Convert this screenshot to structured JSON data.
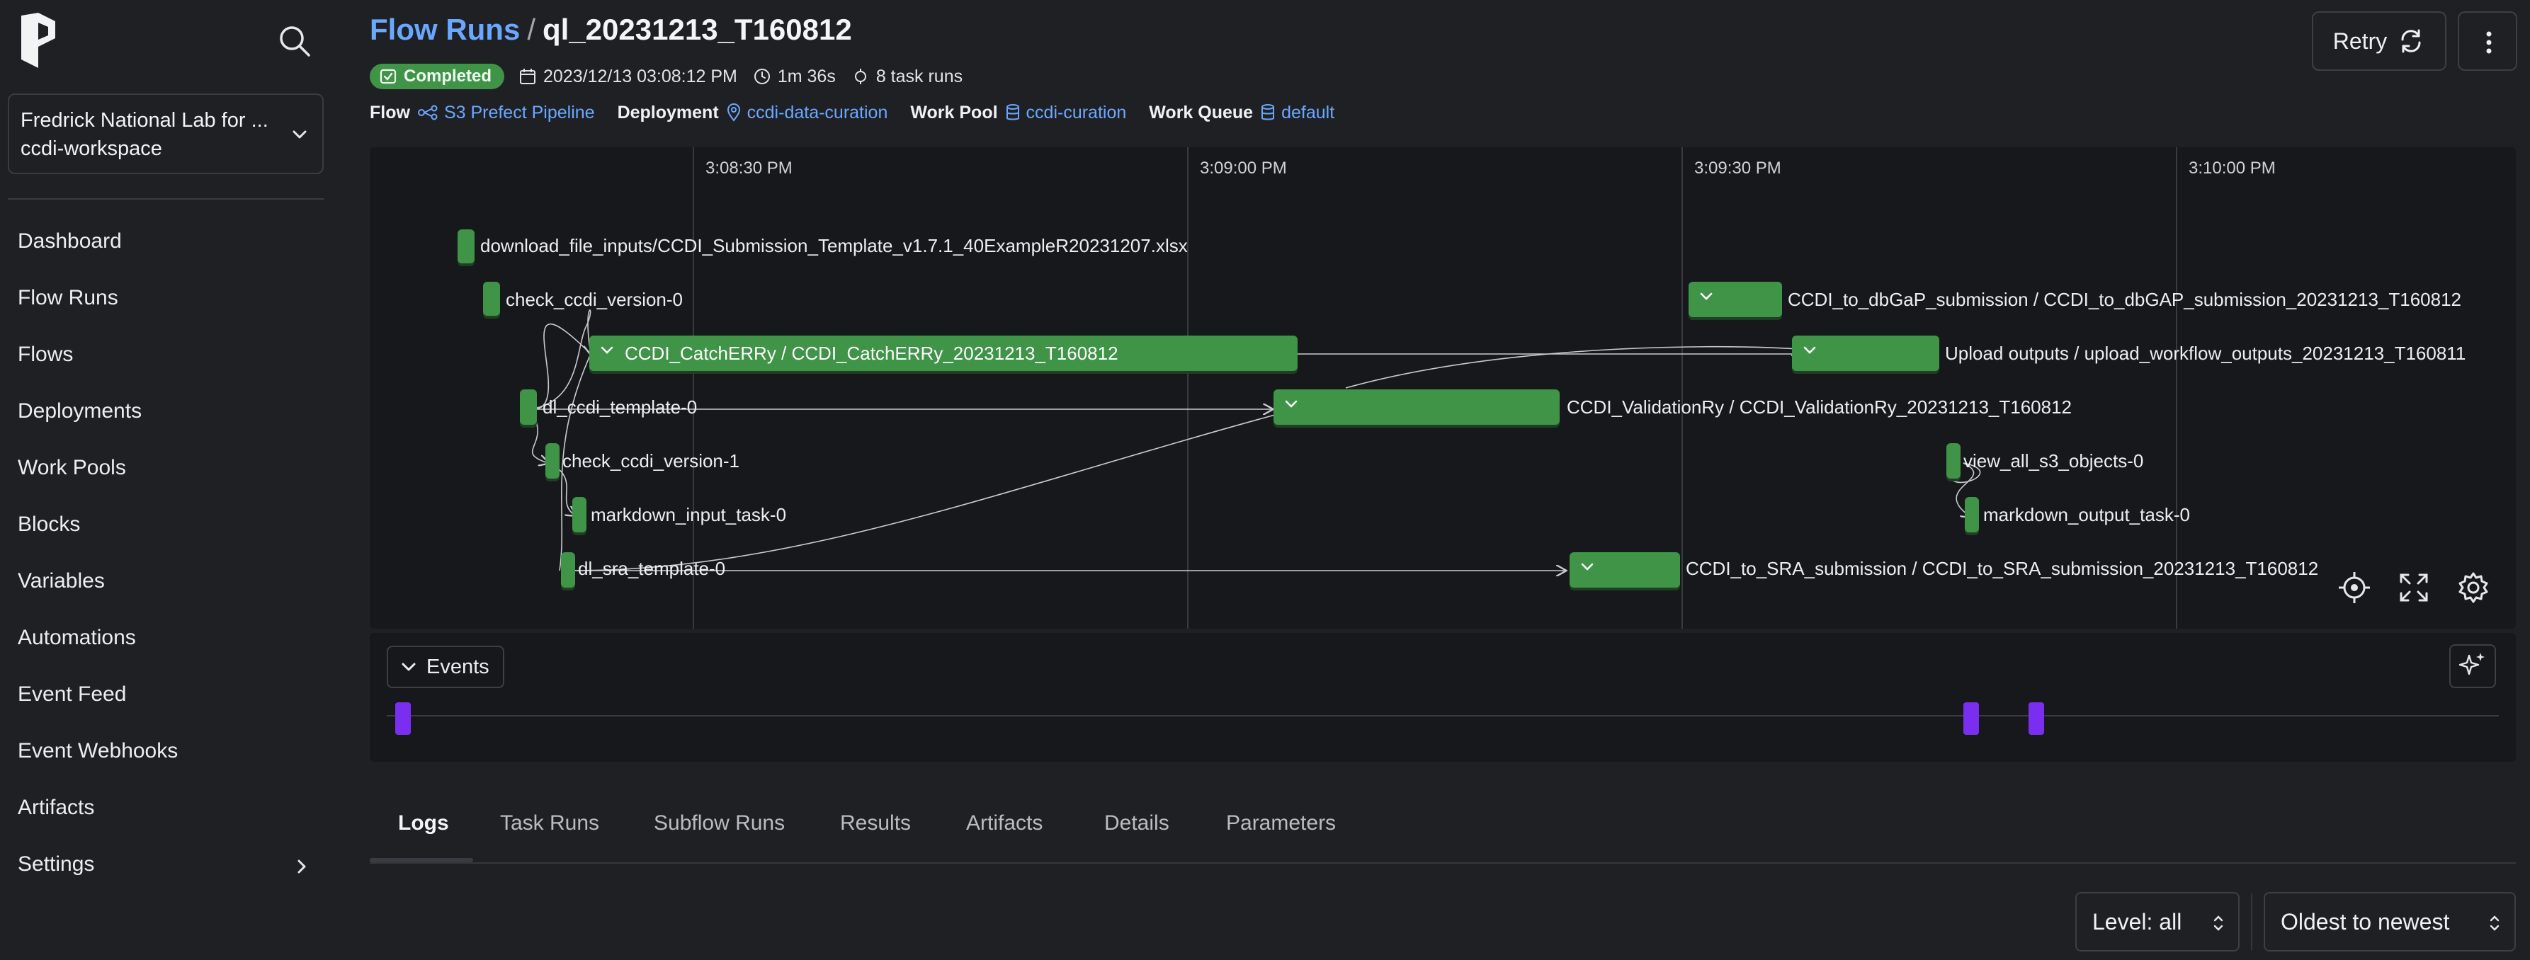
{
  "sidebar": {
    "workspace": {
      "account": "Fredrick National Lab for ...",
      "name": "ccdi-workspace"
    },
    "items": [
      {
        "label": "Dashboard"
      },
      {
        "label": "Flow Runs"
      },
      {
        "label": "Flows"
      },
      {
        "label": "Deployments"
      },
      {
        "label": "Work Pools"
      },
      {
        "label": "Blocks"
      },
      {
        "label": "Variables"
      },
      {
        "label": "Automations"
      },
      {
        "label": "Event Feed"
      },
      {
        "label": "Event Webhooks"
      },
      {
        "label": "Artifacts"
      },
      {
        "label": "Settings"
      }
    ]
  },
  "header": {
    "breadcrumb_root": "Flow Runs",
    "breadcrumb_sep": "/",
    "title": "ql_20231213_T160812",
    "status": "Completed",
    "date": "2023/12/13 03:08:12 PM",
    "duration": "1m 36s",
    "task_runs": "8 task runs",
    "flow_key": "Flow",
    "flow_val": "S3 Prefect Pipeline",
    "deployment_key": "Deployment",
    "deployment_val": "ccdi-data-curation",
    "pool_key": "Work Pool",
    "pool_val": "ccdi-curation",
    "queue_key": "Work Queue",
    "queue_val": "default",
    "retry_label": "Retry"
  },
  "timeline": {
    "ticks": [
      "3:08:30 PM",
      "3:09:00 PM",
      "3:09:30 PM",
      "3:10:00 PM"
    ],
    "nodes": [
      {
        "label": "download_file_inputs/CCDI_Submission_Template_v1.7.1_40ExampleR20231207.xlsx"
      },
      {
        "label": "check_ccdi_version-0"
      },
      {
        "label": "CCDI_CatchERRy / CCDI_CatchERRy_20231213_T160812"
      },
      {
        "label": "dl_ccdi_template-0"
      },
      {
        "label": "check_ccdi_version-1"
      },
      {
        "label": "markdown_input_task-0"
      },
      {
        "label": "dl_sra_template-0"
      },
      {
        "label": "CCDI_ValidationRy / CCDI_ValidationRy_20231213_T160812"
      },
      {
        "label": "CCDI_to_SRA_submission / CCDI_to_SRA_submission_20231213_T160812"
      },
      {
        "label": "CCDI_to_dbGaP_submission / CCDI_to_dbGAP_submission_20231213_T160812"
      },
      {
        "label": "Upload outputs / upload_workflow_outputs_20231213_T160811"
      },
      {
        "label": "view_all_s3_objects-0"
      },
      {
        "label": "markdown_output_task-0"
      }
    ]
  },
  "events": {
    "label": "Events"
  },
  "tabs": [
    "Logs",
    "Task Runs",
    "Subflow Runs",
    "Results",
    "Artifacts",
    "Details",
    "Parameters"
  ],
  "logs": {
    "level": "Level: all",
    "order": "Oldest to newest"
  },
  "colors": {
    "accent": "#6aa8ff",
    "success": "#3f9447",
    "event": "#7a2ff0"
  }
}
